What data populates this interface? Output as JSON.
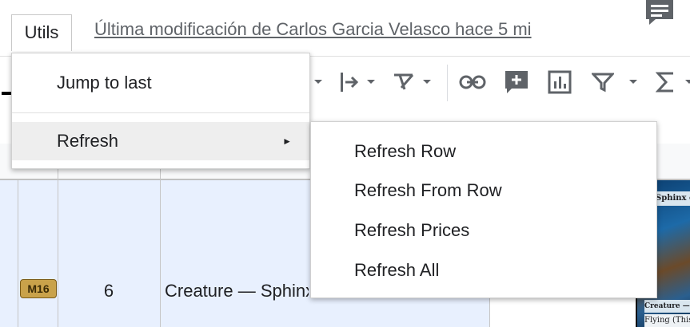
{
  "menubar": {
    "utils_label": "Utils",
    "last_edit": "Última modificación de Carlos Garcia Velasco hace 5 mi"
  },
  "toolbar": {
    "icons": [
      "align-icon",
      "insert-link-icon",
      "insert-comment-icon",
      "insert-chart-icon",
      "filter-icon",
      "functions-icon"
    ]
  },
  "utils_menu": {
    "items": [
      {
        "label": "Jump to last"
      },
      {
        "label": "Refresh",
        "has_submenu": true,
        "submenu_arrow": "►"
      }
    ]
  },
  "refresh_submenu": {
    "items": [
      {
        "label": "Refresh Row"
      },
      {
        "label": "Refresh From Row"
      },
      {
        "label": "Refresh Prices"
      },
      {
        "label": "Refresh All"
      }
    ]
  },
  "grid": {
    "row": {
      "set_symbol": "M16",
      "count": "6",
      "type_line": "Creature — Sphinx",
      "card_title": "Sphinx of M",
      "card_typeline": "Creature — Sp",
      "card_text": "Flying (This"
    }
  },
  "colors": {
    "selection_bg": "#e8f0fe",
    "menu_highlight": "#eeeeee"
  }
}
